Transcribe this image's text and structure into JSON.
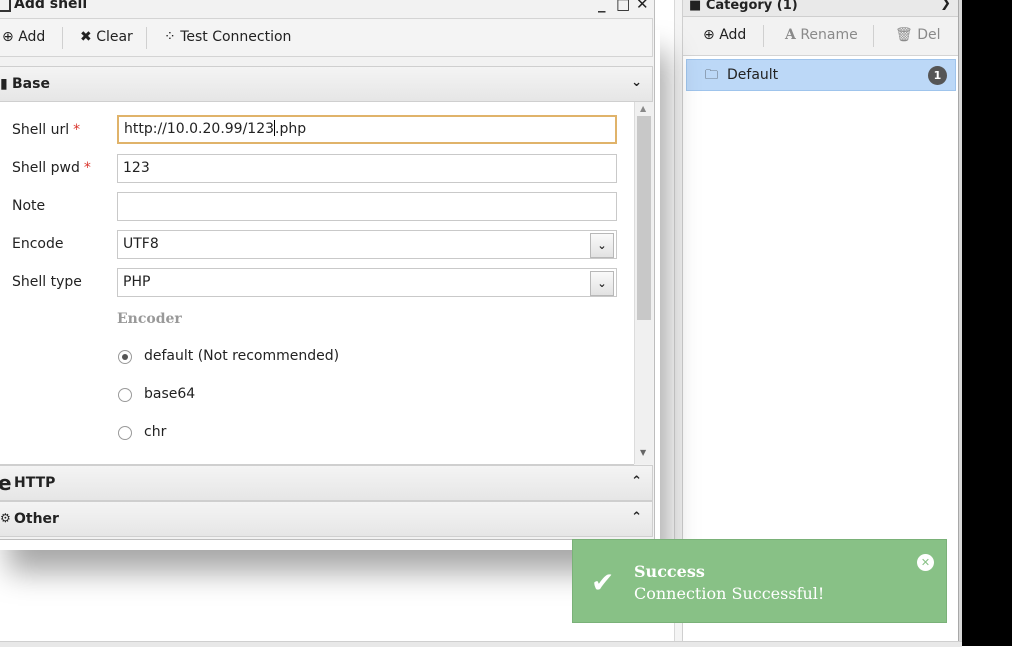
{
  "dialog": {
    "title": "Add shell",
    "controls": {
      "minimize": "_",
      "maximize": "□",
      "close": "✕"
    },
    "toolbar": {
      "add_icon": "plus-circle-icon",
      "add_label": "Add",
      "clear_icon": "x-icon",
      "clear_label": "Clear",
      "test_icon": "spinner-icon",
      "test_label": "Test Connection"
    },
    "sections": {
      "base": {
        "label": "Base",
        "icon": "file-icon",
        "expanded": true
      },
      "http": {
        "label": "HTTP",
        "icon": "ie-icon",
        "expanded": false
      },
      "other": {
        "label": "Other",
        "icon": "cogs-icon",
        "expanded": false
      }
    },
    "form": {
      "shell_url": {
        "label": "Shell url",
        "required_mark": "*",
        "value_before_caret": "http://10.0.20.99/123",
        "value_after_caret": ".php"
      },
      "shell_pwd": {
        "label": "Shell pwd",
        "required_mark": "*",
        "value": "123"
      },
      "note": {
        "label": "Note",
        "value": ""
      },
      "encode": {
        "label": "Encode",
        "selected": "UTF8"
      },
      "shell_type": {
        "label": "Shell type",
        "selected": "PHP"
      },
      "encoder": {
        "title": "Encoder",
        "options": [
          {
            "label": "default (Not recommended)",
            "checked": true
          },
          {
            "label": "base64",
            "checked": false
          },
          {
            "label": "chr",
            "checked": false
          }
        ]
      }
    }
  },
  "category": {
    "title": "Category (1)",
    "toolbar": {
      "add_label": "Add",
      "rename_label": "Rename",
      "del_label": "Del"
    },
    "items": [
      {
        "label": "Default",
        "count": "1"
      }
    ]
  },
  "toast": {
    "title": "Success",
    "message": "Connection Successful!",
    "color": "#88c186"
  }
}
